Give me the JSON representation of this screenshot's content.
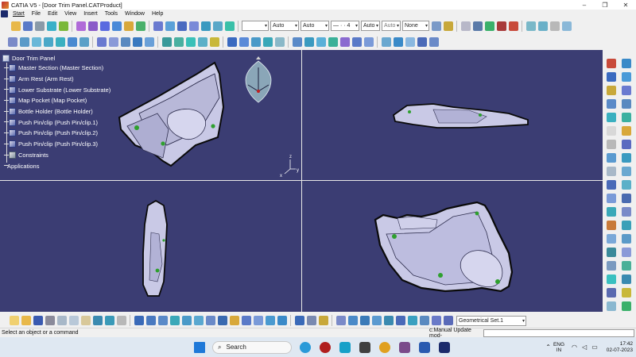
{
  "window": {
    "title": "CATIA V5 - [Door Trim Panel.CATProduct]",
    "minimize": "–",
    "restore": "❐",
    "close": "✕"
  },
  "menu": [
    "Start",
    "File",
    "Edit",
    "View",
    "Insert",
    "Tools",
    "Window",
    "Help"
  ],
  "toolbar_props": {
    "line_type": "Auto",
    "thickness": "Auto",
    "dash": "— · · 4",
    "point_type": "Auto",
    "layer": "Auto",
    "visibility": "None"
  },
  "tree": {
    "root": "Door Trim Panel",
    "children": [
      {
        "label": "Master Section (Master Section)",
        "icon": "part-icon"
      },
      {
        "label": "Arm Rest (Arm Rest)",
        "icon": "part-icon"
      },
      {
        "label": "Lower Substrate (Lower Substrate)",
        "icon": "part-icon"
      },
      {
        "label": "Map Pocket (Map Pocket)",
        "icon": "part-icon"
      },
      {
        "label": "Bottle Holder (Bottle Holder)",
        "icon": "part-icon"
      },
      {
        "label": "Push Pin/clip (Push Pin/clip.1)",
        "icon": "part-icon"
      },
      {
        "label": "Push Pin/clip (Push Pin/clip.2)",
        "icon": "part-icon"
      },
      {
        "label": "Push Pin/clip (Push Pin/clip.3)",
        "icon": "part-icon"
      },
      {
        "label": "Constraints",
        "icon": "constraints-icon"
      }
    ],
    "applications": "Applications"
  },
  "compass_axes": {
    "x": "x",
    "y": "y",
    "z": "z"
  },
  "geometrical_set": "Geometrical Set.1",
  "status": {
    "message": "Select an object or a command",
    "command": "c:Manual Update mod-"
  },
  "taskbar": {
    "search": "Search",
    "lang_line1": "ENG",
    "lang_line2": "IN",
    "time": "17:42",
    "date": "02-07-2023"
  },
  "colors": {
    "viewport_bg": "#3b3d73",
    "part_fill": "#c9c9e6",
    "part_edge": "#0a0a0a",
    "clip_green": "#2ea02e"
  }
}
